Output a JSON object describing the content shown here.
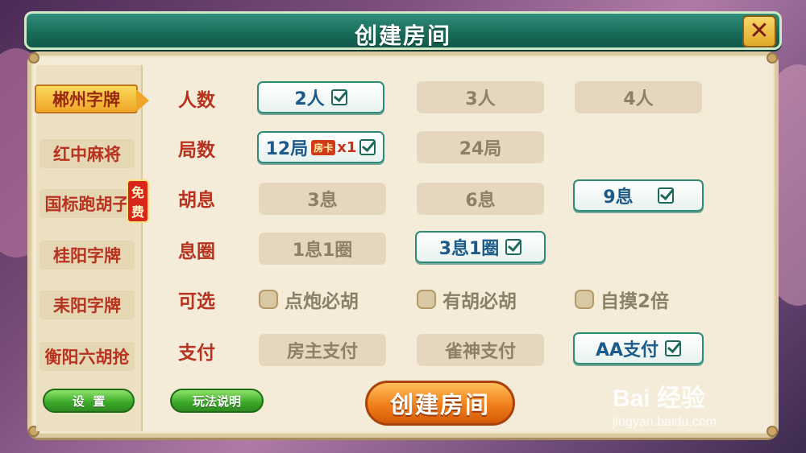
{
  "window": {
    "title": "创建房间"
  },
  "sidebar": {
    "items": [
      {
        "label": "郴州字牌",
        "active": true
      },
      {
        "label": "红中麻将"
      },
      {
        "label": "国标跑胡子",
        "badge": "免费"
      },
      {
        "label": "桂阳字牌"
      },
      {
        "label": "耒阳字牌"
      },
      {
        "label": "衡阳六胡抢"
      }
    ]
  },
  "rows": {
    "players": {
      "label": "人数",
      "options": [
        "2人",
        "3人",
        "4人"
      ],
      "selected": "2人"
    },
    "rounds": {
      "label": "局数",
      "options": [
        "12局",
        "24局"
      ],
      "selected": "12局",
      "card_tag": "房卡",
      "card_mult": "x1"
    },
    "huxi": {
      "label": "胡息",
      "options": [
        "3息",
        "6息",
        "9息"
      ],
      "selected": "9息"
    },
    "xiquan": {
      "label": "息圈",
      "options": [
        "1息1圈",
        "3息1圈"
      ],
      "selected": "3息1圈"
    },
    "optional": {
      "label": "可选",
      "options": [
        "点炮必胡",
        "有胡必胡",
        "自摸2倍"
      ]
    },
    "payment": {
      "label": "支付",
      "options": [
        "房主支付",
        "雀神支付",
        "AA支付"
      ],
      "selected": "AA支付"
    }
  },
  "footer": {
    "settings_label": "设  置",
    "rules_label": "玩法说明",
    "create_label": "创建房间"
  },
  "watermark": {
    "logo": "Bai 经验",
    "url": "jingyan.baidu.com"
  },
  "colors": {
    "accent_red": "#b8331f",
    "teal": "#176a58",
    "selected_text": "#1c5a8a"
  }
}
